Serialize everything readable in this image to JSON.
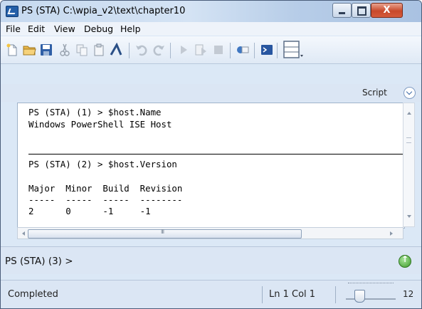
{
  "window": {
    "title": "PS (STA)  C:\\wpia_v2\\text\\chapter10",
    "close_glyph": "X"
  },
  "menu": [
    "File",
    "Edit",
    "View",
    "Debug",
    "Help"
  ],
  "toolbar": {
    "icons": [
      "new-file-icon",
      "open-folder-icon",
      "save-icon",
      "cut-icon",
      "copy-icon",
      "paste-icon",
      "clear-icon",
      "undo-icon",
      "redo-icon",
      "run-icon",
      "run-selection-icon",
      "stop-icon",
      "remote-icon",
      "console-icon",
      "layout-icon"
    ]
  },
  "script_pane": {
    "label": "Script"
  },
  "output": {
    "lines": [
      "PS (STA) (1) > $host.Name",
      "Windows PowerShell ISE Host",
      "PS (STA) (2) > $host.Version",
      "Major  Minor  Build  Revision",
      "-----  -----  -----  --------",
      "2      0      -1     -1"
    ]
  },
  "command": {
    "prompt": "PS (STA) (3) >"
  },
  "status": {
    "text": "Completed",
    "position": "Ln 1  Col 1",
    "zoom": "12"
  },
  "colors": {
    "accent": "#dbe6f4",
    "close_red": "#c8492b"
  }
}
